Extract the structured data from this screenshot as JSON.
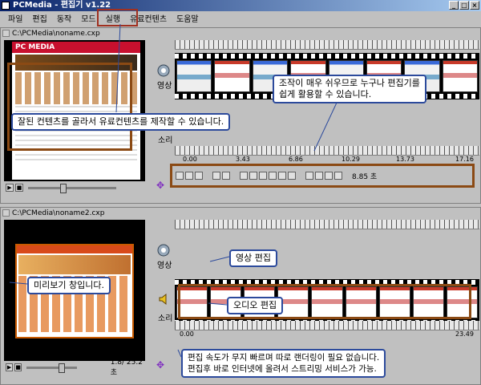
{
  "window": {
    "title": "PCMedia - 편집기 v1.22"
  },
  "menu": [
    "파일",
    "편집",
    "동작",
    "모드",
    "실행",
    "유료컨텐츠",
    "도움말"
  ],
  "panel1": {
    "path": "C:\\PCMedia\\noname.cxp",
    "preview_heading": "PC MEDIA",
    "video_label": "영상",
    "audio_label": "소리",
    "ticks": [
      "0.00",
      "3.43",
      "6.86",
      "10.29",
      "13.73",
      "17.16"
    ],
    "duration": "8.85 초"
  },
  "panel2": {
    "path": "C:\\PCMedia\\noname2.cxp",
    "video_label": "영상",
    "audio_label": "소리",
    "ticks": [
      "0.00",
      "23.49"
    ],
    "counter": "1.8/  25.2초"
  },
  "callouts": {
    "c1": "조작이 매우 쉬우므로 누구나 편집기를\n쉽게 활용할 수 있습니다.",
    "c2": "잘된 컨텐츠를 골라서 유료컨텐츠를 제작할 수 있습니다.",
    "c3": "영상 편집",
    "c4": "미리보기 창입니다.",
    "c5": "오디오 편집",
    "c6": "편집 속도가 무지 빠르며 따로 랜더링이 필요 없습니다.\n편집후 바로 인터넷에 올려서 스트리밍 서비스가 가능."
  },
  "colors": {
    "callout_border": "#2c4a9c",
    "highlight_box": "#8b4a14",
    "menu_highlight": "#a03020"
  }
}
